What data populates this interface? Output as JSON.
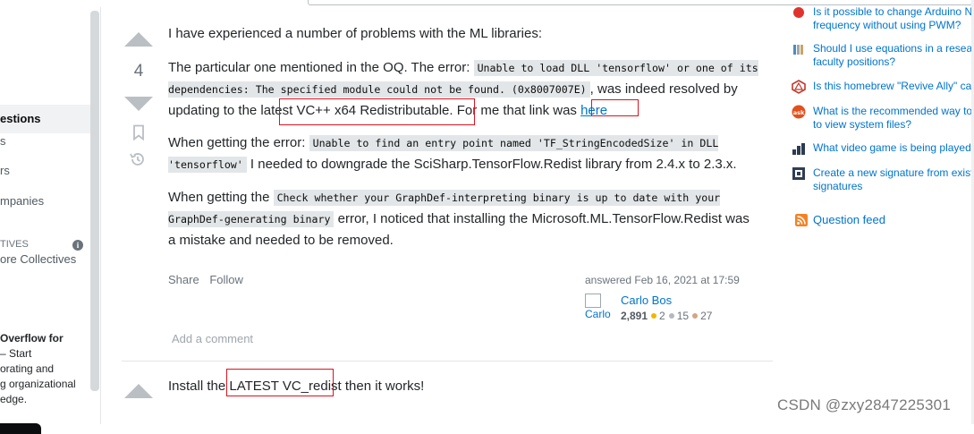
{
  "leftnav": {
    "active_item": "estions",
    "items": [
      "s",
      "rs",
      "mpanies"
    ],
    "collectives_header": "TIVES",
    "explore_collectives": "ore Collectives",
    "teams_title": "Overflow for",
    "teams_lines": [
      "– Start",
      "orating and",
      "g organizational",
      "edge."
    ]
  },
  "answer1": {
    "vote_count": "4",
    "p1": "I have experienced a number of problems with the ML libraries:",
    "p2_a": "The particular one mentioned in the OQ. The error: ",
    "p2_code": "Unable to load DLL 'tensorflow' or one of its dependencies: The specified module could not be found. (0x8007007E)",
    "p2_b": ", was indeed resolved by updating to the ",
    "p2_highlight": "latest VC++ x64 Redistributable.",
    "p2_c": " For me that link was ",
    "p2_link": "here",
    "p3_a": "When getting the error: ",
    "p3_code": "Unable to find an entry point named 'TF_StringEncodedSize' in DLL 'tensorflow'",
    "p3_b": " I needed to downgrade the SciSharp.TensorFlow.Redist library from 2.4.x to 2.3.x.",
    "p4_a": "When getting the ",
    "p4_code": "Check whether your GraphDef-interpreting binary is up to date with your GraphDef-generating binary",
    "p4_b": " error, I noticed that installing the Microsoft.ML.TensorFlow.Redist was a mistake and needed to be removed.",
    "share": "Share",
    "follow": "Follow",
    "action_time": "answered Feb 16, 2021 at 17:59",
    "avatar_alt": "Carlo",
    "user_name": "Carlo Bos",
    "reputation": "2,891",
    "gold": "2",
    "silver": "15",
    "bronze": "27",
    "add_comment": "Add a comment"
  },
  "answer2": {
    "text_a": "Install the ",
    "highlight": "LATEST VC_redist",
    "text_b": " then it works!"
  },
  "sidebar": {
    "hot_questions": [
      {
        "icon": "arduino-icon",
        "text": "Is it possible to change Arduino N\nfrequency without using PWM?"
      },
      {
        "icon": "academia-icon",
        "text": "Should I use equations in a researc\nfaculty positions?"
      },
      {
        "icon": "rpg-icon",
        "text": "Is this homebrew \"Revive Ally\" can"
      },
      {
        "icon": "askubuntu-icon",
        "text": "What is the recommended way to\nto view system files?"
      },
      {
        "icon": "gaming-icon",
        "text": "What video game is being played"
      },
      {
        "icon": "tex-icon",
        "text": "Create a new signature from existi\nsignatures"
      }
    ],
    "feed_label": "Question feed"
  },
  "watermark": "CSDN @zxy2847225301",
  "colors": {
    "accent": "#f48225",
    "link": "#0074cc",
    "highlight_box": "#d9141e"
  }
}
